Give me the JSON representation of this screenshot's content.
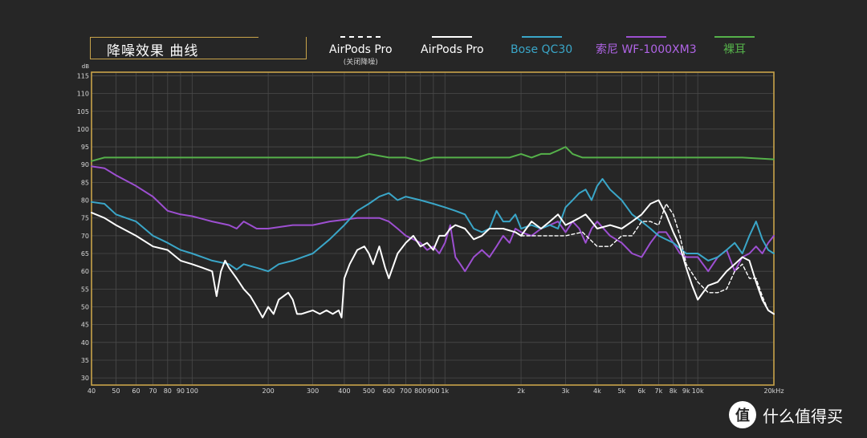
{
  "title": "降噪效果 曲线",
  "watermark": {
    "logo": "值",
    "text": "什么值得买"
  },
  "colors": {
    "background": "#262626",
    "frame": "#c8a34a",
    "grid": "#4a4a4a"
  },
  "chart_data": {
    "type": "line",
    "title": "降噪效果 曲线",
    "x_scale": "log",
    "x_unit": "Hz",
    "y_unit": "dB",
    "xlim": [
      40,
      20000
    ],
    "ylim": [
      28,
      116
    ],
    "grid": true,
    "legend_position": "top",
    "x_ticks": [
      {
        "v": 40,
        "label": "40"
      },
      {
        "v": 50,
        "label": "50"
      },
      {
        "v": 60,
        "label": "60"
      },
      {
        "v": 70,
        "label": "70"
      },
      {
        "v": 80,
        "label": "80"
      },
      {
        "v": 90,
        "label": "90"
      },
      {
        "v": 100,
        "label": "100"
      },
      {
        "v": 200,
        "label": "200"
      },
      {
        "v": 300,
        "label": "300"
      },
      {
        "v": 400,
        "label": "400"
      },
      {
        "v": 500,
        "label": "500"
      },
      {
        "v": 600,
        "label": "600"
      },
      {
        "v": 700,
        "label": "700"
      },
      {
        "v": 800,
        "label": "800"
      },
      {
        "v": 900,
        "label": "900"
      },
      {
        "v": 1000,
        "label": "1k"
      },
      {
        "v": 2000,
        "label": "2k"
      },
      {
        "v": 3000,
        "label": "3k"
      },
      {
        "v": 4000,
        "label": "4k"
      },
      {
        "v": 5000,
        "label": "5k"
      },
      {
        "v": 6000,
        "label": "6k"
      },
      {
        "v": 7000,
        "label": "7k"
      },
      {
        "v": 8000,
        "label": "8k"
      },
      {
        "v": 9000,
        "label": "9k"
      },
      {
        "v": 10000,
        "label": "10k"
      },
      {
        "v": 20000,
        "label": "20kHz"
      }
    ],
    "y_ticks": [
      115,
      110,
      105,
      100,
      95,
      90,
      85,
      80,
      75,
      70,
      65,
      60,
      55,
      50,
      45,
      40,
      35,
      30
    ],
    "y_unit_label": "dB",
    "series": [
      {
        "name": "AirPods Pro",
        "sub": "(关闭降噪)",
        "color": "#ffffff",
        "dashed": true,
        "points": [
          [
            2000,
            70
          ],
          [
            2500,
            70
          ],
          [
            3000,
            70
          ],
          [
            3500,
            71
          ],
          [
            4000,
            67
          ],
          [
            4500,
            67
          ],
          [
            5000,
            70
          ],
          [
            5500,
            70
          ],
          [
            6000,
            74
          ],
          [
            6500,
            74
          ],
          [
            7000,
            73
          ],
          [
            7500,
            79
          ],
          [
            8000,
            76
          ],
          [
            8500,
            70
          ],
          [
            9000,
            62
          ],
          [
            10000,
            57
          ],
          [
            11000,
            54
          ],
          [
            12000,
            54
          ],
          [
            13000,
            55
          ],
          [
            14000,
            60
          ],
          [
            15000,
            62
          ],
          [
            16000,
            58
          ],
          [
            17000,
            58
          ],
          [
            18000,
            53
          ],
          [
            19000,
            49
          ],
          [
            20000,
            48
          ]
        ]
      },
      {
        "name": "AirPods Pro",
        "color": "#ffffff",
        "dashed": false,
        "points": [
          [
            40,
            76.5
          ],
          [
            45,
            75
          ],
          [
            50,
            73
          ],
          [
            60,
            70
          ],
          [
            70,
            67
          ],
          [
            80,
            66
          ],
          [
            90,
            63
          ],
          [
            100,
            62
          ],
          [
            110,
            61
          ],
          [
            120,
            60
          ],
          [
            125,
            53
          ],
          [
            130,
            60
          ],
          [
            135,
            63
          ],
          [
            140,
            61
          ],
          [
            150,
            58
          ],
          [
            160,
            55
          ],
          [
            170,
            53
          ],
          [
            180,
            50
          ],
          [
            190,
            47
          ],
          [
            200,
            50
          ],
          [
            210,
            48
          ],
          [
            220,
            52
          ],
          [
            230,
            53
          ],
          [
            240,
            54
          ],
          [
            250,
            52
          ],
          [
            260,
            48
          ],
          [
            270,
            48
          ],
          [
            300,
            49
          ],
          [
            320,
            48
          ],
          [
            340,
            49
          ],
          [
            360,
            48
          ],
          [
            380,
            49
          ],
          [
            390,
            47
          ],
          [
            400,
            58
          ],
          [
            420,
            62
          ],
          [
            450,
            66
          ],
          [
            480,
            67
          ],
          [
            500,
            65
          ],
          [
            520,
            62
          ],
          [
            550,
            67
          ],
          [
            580,
            61
          ],
          [
            600,
            58
          ],
          [
            650,
            65
          ],
          [
            700,
            68
          ],
          [
            750,
            70
          ],
          [
            800,
            67
          ],
          [
            850,
            68
          ],
          [
            900,
            66
          ],
          [
            950,
            70
          ],
          [
            1000,
            70
          ],
          [
            1050,
            72
          ],
          [
            1100,
            73
          ],
          [
            1200,
            72
          ],
          [
            1300,
            69
          ],
          [
            1400,
            70
          ],
          [
            1500,
            72
          ],
          [
            1700,
            72
          ],
          [
            1900,
            71
          ],
          [
            2000,
            70
          ],
          [
            2200,
            74
          ],
          [
            2400,
            72
          ],
          [
            2600,
            74
          ],
          [
            2800,
            76
          ],
          [
            3000,
            73
          ],
          [
            3200,
            74
          ],
          [
            3400,
            75
          ],
          [
            3600,
            76
          ],
          [
            3800,
            74
          ],
          [
            4000,
            72
          ],
          [
            4500,
            73
          ],
          [
            5000,
            72
          ],
          [
            5500,
            74
          ],
          [
            6000,
            76
          ],
          [
            6500,
            79
          ],
          [
            7000,
            80
          ],
          [
            7500,
            76
          ],
          [
            8000,
            71
          ],
          [
            8500,
            67
          ],
          [
            9000,
            61
          ],
          [
            9500,
            56
          ],
          [
            10000,
            52
          ],
          [
            11000,
            56
          ],
          [
            12000,
            57
          ],
          [
            13000,
            60
          ],
          [
            14000,
            62
          ],
          [
            15000,
            64
          ],
          [
            16000,
            63
          ],
          [
            17000,
            57
          ],
          [
            18000,
            52
          ],
          [
            19000,
            49
          ],
          [
            20000,
            48
          ]
        ]
      },
      {
        "name": "Bose QC30",
        "color": "#3aa6c8",
        "dashed": false,
        "points": [
          [
            40,
            79.5
          ],
          [
            45,
            79
          ],
          [
            50,
            76
          ],
          [
            60,
            74
          ],
          [
            70,
            70
          ],
          [
            80,
            68
          ],
          [
            90,
            66
          ],
          [
            100,
            65
          ],
          [
            120,
            63
          ],
          [
            140,
            62
          ],
          [
            150,
            60.5
          ],
          [
            160,
            62
          ],
          [
            180,
            61
          ],
          [
            200,
            60
          ],
          [
            220,
            62
          ],
          [
            250,
            63
          ],
          [
            300,
            65
          ],
          [
            350,
            69
          ],
          [
            400,
            73
          ],
          [
            450,
            77
          ],
          [
            500,
            79
          ],
          [
            550,
            81
          ],
          [
            600,
            82
          ],
          [
            650,
            80
          ],
          [
            700,
            81
          ],
          [
            800,
            80
          ],
          [
            900,
            79
          ],
          [
            1000,
            78
          ],
          [
            1100,
            77
          ],
          [
            1200,
            76
          ],
          [
            1300,
            72
          ],
          [
            1400,
            71
          ],
          [
            1500,
            72
          ],
          [
            1600,
            77
          ],
          [
            1700,
            74
          ],
          [
            1800,
            74
          ],
          [
            1900,
            76
          ],
          [
            2000,
            72
          ],
          [
            2200,
            73
          ],
          [
            2400,
            72
          ],
          [
            2600,
            73
          ],
          [
            2800,
            72
          ],
          [
            3000,
            78
          ],
          [
            3200,
            80
          ],
          [
            3400,
            82
          ],
          [
            3600,
            83
          ],
          [
            3800,
            80
          ],
          [
            4000,
            84
          ],
          [
            4200,
            86
          ],
          [
            4500,
            83
          ],
          [
            5000,
            80
          ],
          [
            5500,
            76
          ],
          [
            6000,
            74
          ],
          [
            6500,
            72
          ],
          [
            7000,
            70
          ],
          [
            8000,
            68
          ],
          [
            9000,
            65
          ],
          [
            10000,
            65
          ],
          [
            11000,
            63
          ],
          [
            12000,
            64
          ],
          [
            13000,
            66
          ],
          [
            14000,
            68
          ],
          [
            15000,
            65
          ],
          [
            16000,
            70
          ],
          [
            17000,
            74
          ],
          [
            18000,
            69
          ],
          [
            19000,
            66
          ],
          [
            20000,
            65
          ]
        ]
      },
      {
        "name": "索尼 WF-1000XM3",
        "color": "#9d4fd1",
        "dashed": false,
        "points": [
          [
            40,
            89.5
          ],
          [
            45,
            89
          ],
          [
            50,
            87
          ],
          [
            60,
            84
          ],
          [
            70,
            81
          ],
          [
            80,
            77
          ],
          [
            90,
            76
          ],
          [
            100,
            75.5
          ],
          [
            120,
            74
          ],
          [
            140,
            73
          ],
          [
            150,
            72
          ],
          [
            160,
            74
          ],
          [
            170,
            73
          ],
          [
            180,
            72
          ],
          [
            200,
            72
          ],
          [
            250,
            73
          ],
          [
            300,
            73
          ],
          [
            350,
            74
          ],
          [
            400,
            74.5
          ],
          [
            450,
            75
          ],
          [
            500,
            75
          ],
          [
            550,
            75
          ],
          [
            600,
            74
          ],
          [
            650,
            72
          ],
          [
            700,
            70
          ],
          [
            750,
            69
          ],
          [
            800,
            68
          ],
          [
            850,
            66
          ],
          [
            900,
            67
          ],
          [
            950,
            65
          ],
          [
            1000,
            68
          ],
          [
            1050,
            73
          ],
          [
            1100,
            64
          ],
          [
            1150,
            62
          ],
          [
            1200,
            60
          ],
          [
            1300,
            64
          ],
          [
            1400,
            66
          ],
          [
            1500,
            64
          ],
          [
            1600,
            67
          ],
          [
            1700,
            70
          ],
          [
            1800,
            68
          ],
          [
            1900,
            72
          ],
          [
            2000,
            71
          ],
          [
            2200,
            70
          ],
          [
            2400,
            72
          ],
          [
            2600,
            73
          ],
          [
            2800,
            74
          ],
          [
            3000,
            71
          ],
          [
            3200,
            74
          ],
          [
            3400,
            72
          ],
          [
            3600,
            68
          ],
          [
            3800,
            72
          ],
          [
            4000,
            74
          ],
          [
            4500,
            70
          ],
          [
            5000,
            68
          ],
          [
            5500,
            65
          ],
          [
            6000,
            64
          ],
          [
            6500,
            68
          ],
          [
            7000,
            71
          ],
          [
            7500,
            71
          ],
          [
            8000,
            68
          ],
          [
            8500,
            65
          ],
          [
            9000,
            64
          ],
          [
            10000,
            64
          ],
          [
            11000,
            60
          ],
          [
            12000,
            64
          ],
          [
            13000,
            66
          ],
          [
            14000,
            60
          ],
          [
            15000,
            64
          ],
          [
            16000,
            65
          ],
          [
            17000,
            67
          ],
          [
            18000,
            65
          ],
          [
            19000,
            68
          ],
          [
            20000,
            70
          ]
        ]
      },
      {
        "name": "裸耳",
        "color": "#55b14a",
        "dashed": false,
        "points": [
          [
            40,
            91
          ],
          [
            45,
            92
          ],
          [
            50,
            92
          ],
          [
            60,
            92
          ],
          [
            80,
            92
          ],
          [
            100,
            92
          ],
          [
            150,
            92
          ],
          [
            200,
            92
          ],
          [
            300,
            92
          ],
          [
            400,
            92
          ],
          [
            450,
            92
          ],
          [
            500,
            93
          ],
          [
            600,
            92
          ],
          [
            700,
            92
          ],
          [
            800,
            91
          ],
          [
            900,
            92
          ],
          [
            1000,
            92
          ],
          [
            1200,
            92
          ],
          [
            1400,
            92
          ],
          [
            1600,
            92
          ],
          [
            1800,
            92
          ],
          [
            2000,
            93
          ],
          [
            2200,
            92
          ],
          [
            2400,
            93
          ],
          [
            2600,
            93
          ],
          [
            2800,
            94
          ],
          [
            3000,
            95
          ],
          [
            3200,
            93
          ],
          [
            3500,
            92
          ],
          [
            4000,
            92
          ],
          [
            5000,
            92
          ],
          [
            7000,
            92
          ],
          [
            10000,
            92
          ],
          [
            15000,
            92
          ],
          [
            20000,
            91.5
          ]
        ]
      }
    ]
  }
}
